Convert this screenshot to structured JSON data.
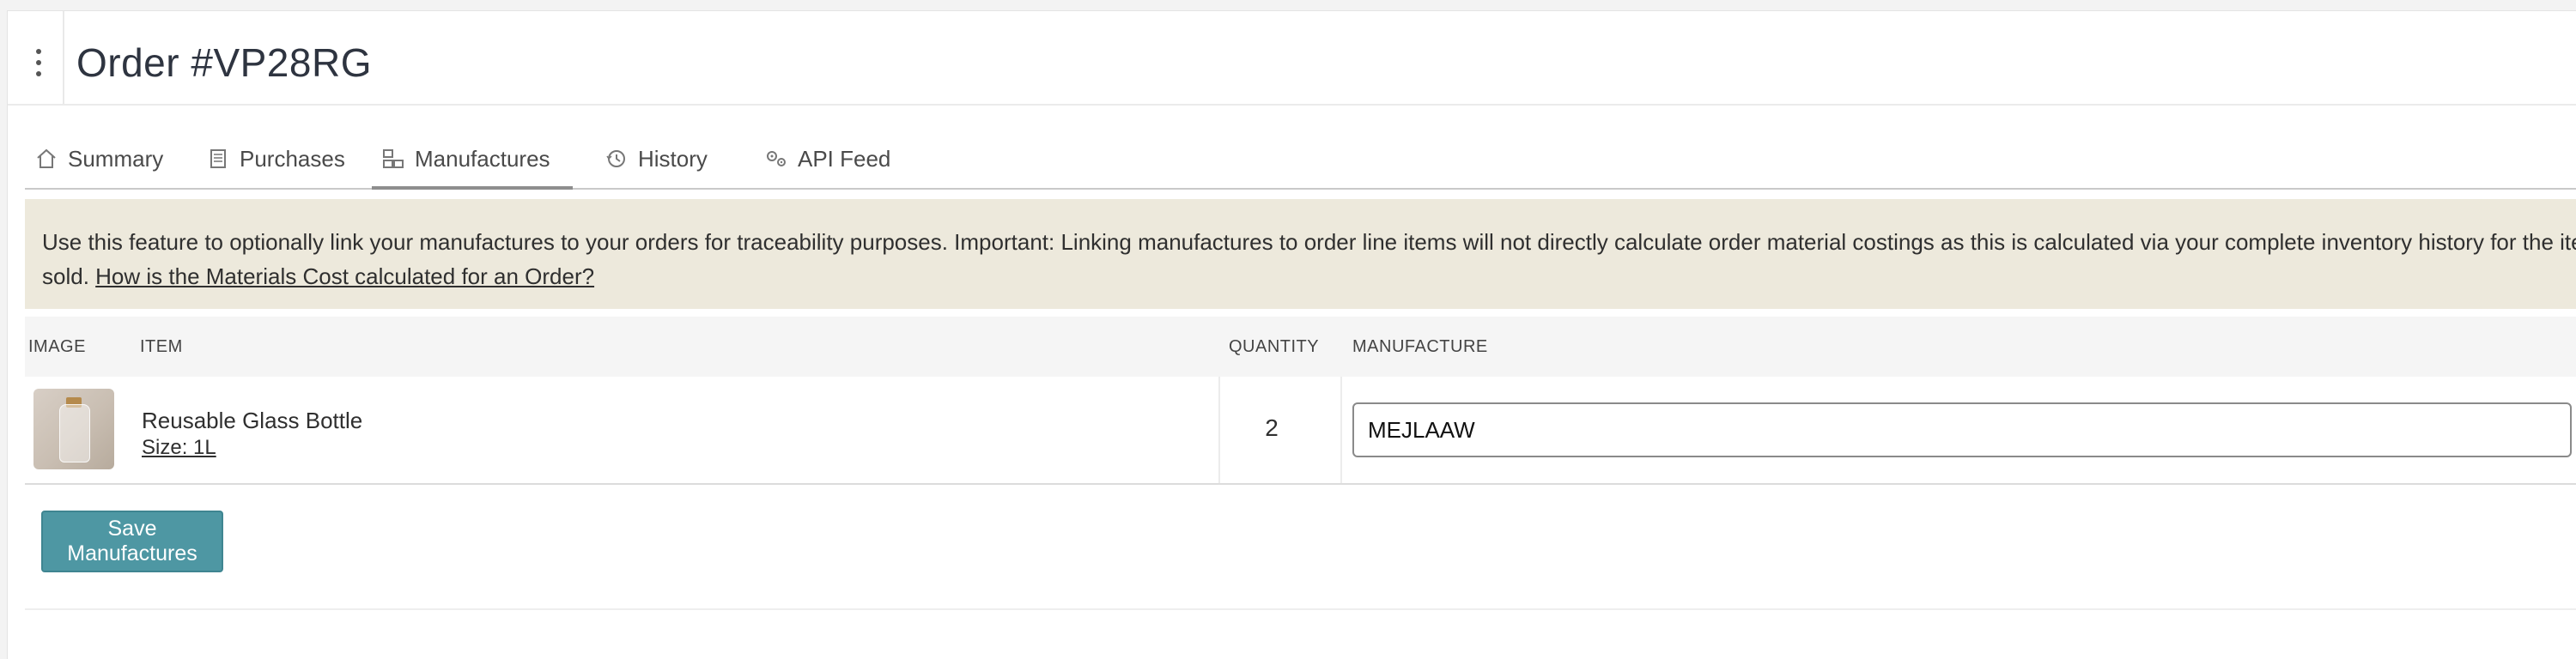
{
  "header": {
    "title": "Order #VP28RG",
    "menu_icon": "kebab-menu-icon"
  },
  "tabs": [
    {
      "label": "Summary",
      "icon": "home-icon",
      "active": false
    },
    {
      "label": "Purchases",
      "icon": "document-icon",
      "active": false
    },
    {
      "label": "Manufactures",
      "icon": "factory-icon",
      "active": true
    },
    {
      "label": "History",
      "icon": "history-icon",
      "active": false
    },
    {
      "label": "API Feed",
      "icon": "gears-icon",
      "active": false
    }
  ],
  "banner": {
    "text": "Use this feature to optionally link your manufactures to your orders for traceability purposes. Important: Linking manufactures to order line items will not directly calculate order material costings as this is calculated via your complete inventory history for the items",
    "text_line2": "sold.",
    "link_text": "How is the Materials Cost calculated for an Order?"
  },
  "table": {
    "columns": [
      "IMAGE",
      "ITEM",
      "QUANTITY",
      "MANUFACTURE"
    ],
    "rows": [
      {
        "image_alt": "glass-bottle-image",
        "item_name": "Reusable Glass Bottle",
        "item_variant": "Size: 1L",
        "quantity": "2",
        "manufacture": "MEJLAAW"
      }
    ]
  },
  "actions": {
    "save_label": "Save Manufactures"
  },
  "colors": {
    "banner_bg": "#ede9dc",
    "button_bg": "#4e97a3",
    "active_tab_underline": "#8e8e8e"
  }
}
